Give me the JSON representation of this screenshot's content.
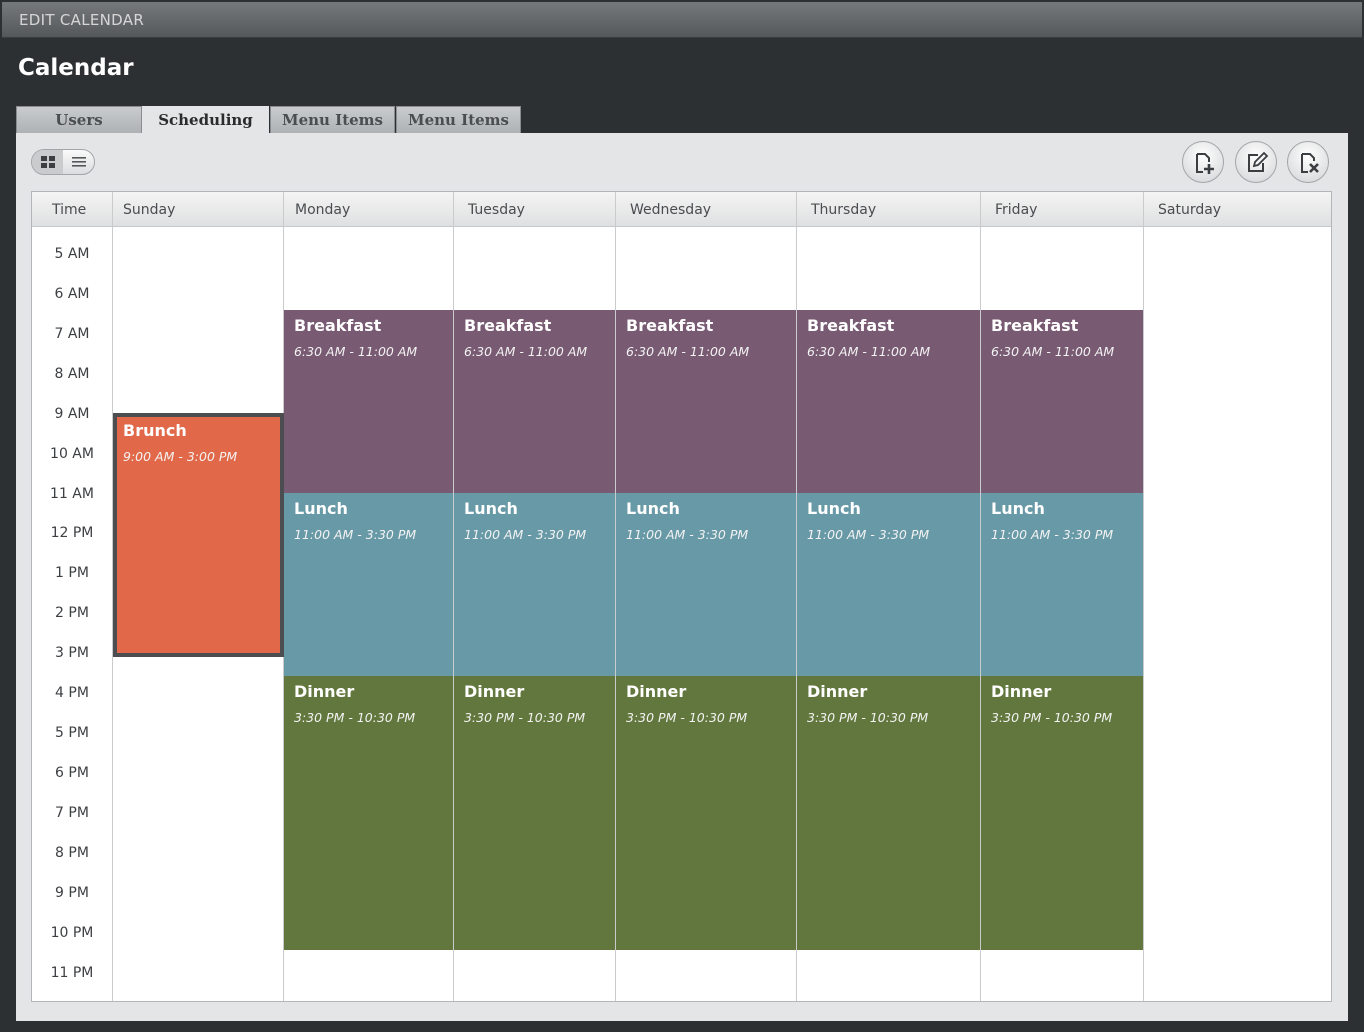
{
  "window": {
    "title": "EDIT CALENDAR"
  },
  "page_title": "Calendar",
  "tabs": [
    {
      "label": "Users",
      "active": false
    },
    {
      "label": "Scheduling",
      "active": true
    },
    {
      "label": "Menu Items",
      "active": false
    },
    {
      "label": "Menu Items",
      "active": false
    }
  ],
  "toolbar": {
    "view_options": [
      "grid-view-icon",
      "list-view-icon"
    ],
    "actions": [
      "add-event-icon",
      "edit-event-icon",
      "delete-event-icon"
    ]
  },
  "calendar": {
    "time_header": "Time",
    "days": [
      "Sunday",
      "Monday",
      "Tuesday",
      "Wednesday",
      "Thursday",
      "Friday",
      "Saturday"
    ],
    "hours": [
      "5 AM",
      "6 AM",
      "7 AM",
      "8 AM",
      "9 AM",
      "10 AM",
      "11 AM",
      "12 PM",
      "1 PM",
      "2 PM",
      "3 PM",
      "4 PM",
      "5 PM",
      "6 PM",
      "7 PM",
      "8 PM",
      "9 PM",
      "10 PM",
      "11 PM"
    ],
    "events": {
      "brunch": {
        "title": "Brunch",
        "time": "9:00 AM - 3:00 PM",
        "days": [
          "Sunday"
        ],
        "color": "#e16848"
      },
      "breakfast": {
        "title": "Breakfast",
        "time": "6:30 AM - 11:00 AM",
        "days": [
          "Monday",
          "Tuesday",
          "Wednesday",
          "Thursday",
          "Friday"
        ],
        "color": "#785a72"
      },
      "lunch": {
        "title": "Lunch",
        "time": "11:00 AM - 3:30 PM",
        "days": [
          "Monday",
          "Tuesday",
          "Wednesday",
          "Thursday",
          "Friday"
        ],
        "color": "#6899a6"
      },
      "dinner": {
        "title": "Dinner",
        "time": "3:30 PM - 10:30 PM",
        "days": [
          "Monday",
          "Tuesday",
          "Wednesday",
          "Thursday",
          "Friday"
        ],
        "color": "#62773d"
      }
    }
  }
}
